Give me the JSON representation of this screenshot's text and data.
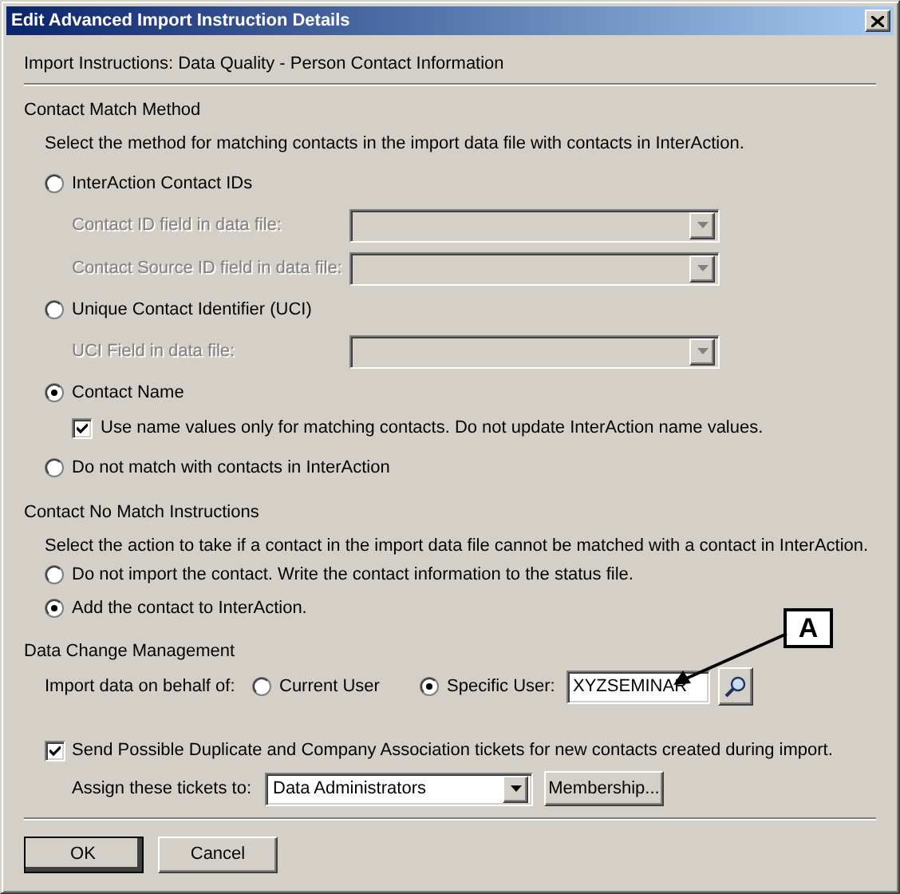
{
  "window": {
    "title": "Edit Advanced Import Instruction Details"
  },
  "header": "Import Instructions: Data Quality - Person Contact Information",
  "match_method": {
    "heading": "Contact Match Method",
    "description": "Select the method for matching contacts in the import data file with contacts in InterAction.",
    "options": [
      {
        "label": "InterAction Contact IDs",
        "selected": false,
        "fields": [
          {
            "label": "Contact ID field in data file:",
            "disabled": true
          },
          {
            "label": "Contact Source ID field in data file:",
            "disabled": true
          }
        ]
      },
      {
        "label": "Unique Contact Identifier (UCI)",
        "selected": false,
        "fields": [
          {
            "label": "UCI Field in data file:",
            "disabled": true
          }
        ]
      },
      {
        "label": "Contact Name",
        "selected": true,
        "checkbox": {
          "label": "Use name values only for matching contacts. Do not update InterAction name values.",
          "checked": true
        }
      },
      {
        "label": "Do not match with contacts in InterAction",
        "selected": false
      }
    ]
  },
  "no_match": {
    "heading": "Contact No Match Instructions",
    "description": "Select the action to take if a contact in the import data file cannot be matched with a contact in InterAction.",
    "options": [
      {
        "label": "Do not import the contact. Write the contact information to the status file.",
        "selected": false
      },
      {
        "label": "Add the contact to InterAction.",
        "selected": true
      }
    ]
  },
  "data_change": {
    "heading": "Data Change Management",
    "label": "Import data on behalf of:",
    "options": [
      {
        "label": "Current User",
        "selected": false
      },
      {
        "label": "Specific User:",
        "selected": true
      }
    ],
    "user_field": {
      "value": "XYZSEMINAR"
    }
  },
  "tickets": {
    "checkbox": {
      "label": "Send Possible Duplicate and Company Association tickets for new contacts created during import.",
      "checked": true
    },
    "assign_label": "Assign these tickets to:",
    "assign_value": "Data Administrators",
    "membership_button": "Membership..."
  },
  "buttons": [
    {
      "label": "OK",
      "default": true
    },
    {
      "label": "Cancel",
      "default": false
    }
  ],
  "callout": {
    "label": "A"
  }
}
